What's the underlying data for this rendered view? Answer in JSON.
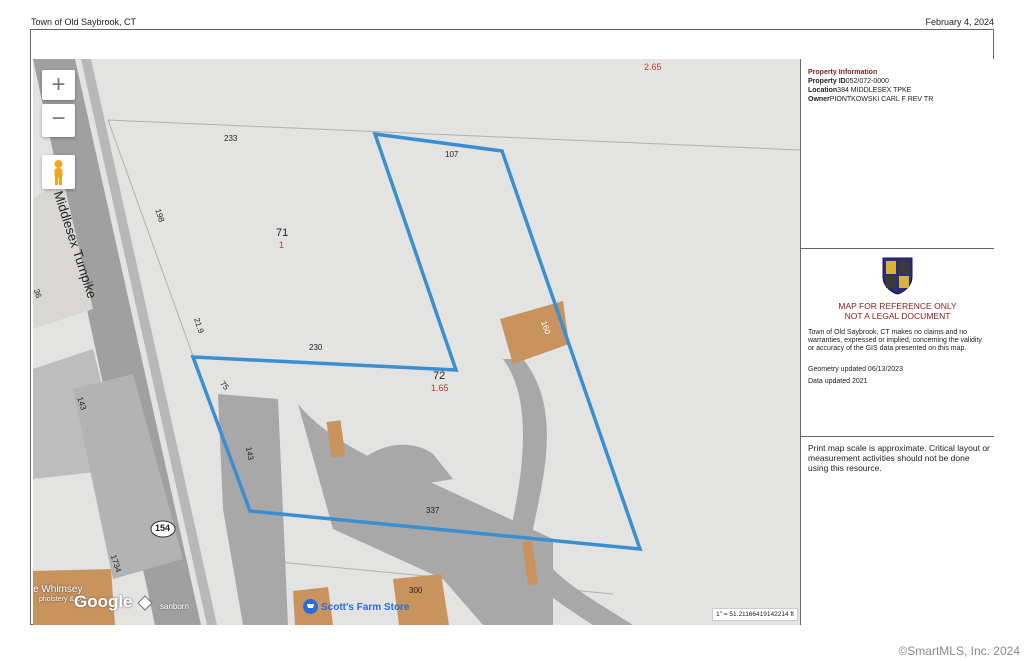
{
  "header": {
    "town": "Town of Old Saybrook, CT",
    "date": "February 4, 2024"
  },
  "panel": {
    "property_info_title": "Property Information",
    "property_id_label": "Property ID",
    "property_id": "052/072-0000",
    "location_label": "Location",
    "location": "384 MIDDLESEX TPKE",
    "owner_label": "Owner",
    "owner": "PIONTKOWSKI CARL F REV TR",
    "ref_line1": "MAP FOR REFERENCE ONLY",
    "ref_line2": "NOT A LEGAL DOCUMENT",
    "disclaimer": "Town of Old Saybrook, CT makes no claims and no warranties, expressed or implied, concerning the validity or accuracy of the GIS data presented on this map.",
    "geometry_updated": "Geometry updated 06/13/2023",
    "data_updated": "Data updated 2021",
    "scale_note": "Print map scale is approximate. Critical layout or measurement activities should not be done using this resource."
  },
  "map": {
    "controls": {
      "zoom_in": "+",
      "zoom_out": "−"
    },
    "road_label": "Middlesex Turnpike",
    "route_shield": "154",
    "parcel_labels": [
      {
        "text": "233",
        "color": "#222222"
      },
      {
        "text": "107",
        "color": "#222222"
      },
      {
        "text": "71",
        "color": "#222222"
      },
      {
        "text": "1",
        "color": "#c0392b"
      },
      {
        "text": "198",
        "color": "#222222"
      },
      {
        "text": "21.9",
        "color": "#222222"
      },
      {
        "text": "230",
        "color": "#222222"
      },
      {
        "text": "72",
        "color": "#222222"
      },
      {
        "text": "1.65",
        "color": "#c0392b"
      },
      {
        "text": "2.65",
        "color": "#c0392b"
      },
      {
        "text": "75",
        "color": "#222222"
      },
      {
        "text": "143",
        "color": "#222222"
      },
      {
        "text": "337",
        "color": "#222222"
      },
      {
        "text": "160",
        "color": "#222222"
      },
      {
        "text": "300",
        "color": "#222222"
      },
      {
        "text": "36",
        "color": "#222222"
      },
      {
        "text": "143",
        "color": "#222222"
      },
      {
        "text": "1734",
        "color": "#222222"
      }
    ],
    "poi_scotts": "Scott's Farm Store",
    "poi_whimsey": "e Whimsey",
    "poi_upholstery": "pholstery & D",
    "google": "Google",
    "sanborn": "sanborn",
    "scale": "1\" = 51.21166419142214 ft",
    "highlight_color": "#3a8fd1"
  },
  "watermark": "©SmartMLS, Inc.  2024"
}
